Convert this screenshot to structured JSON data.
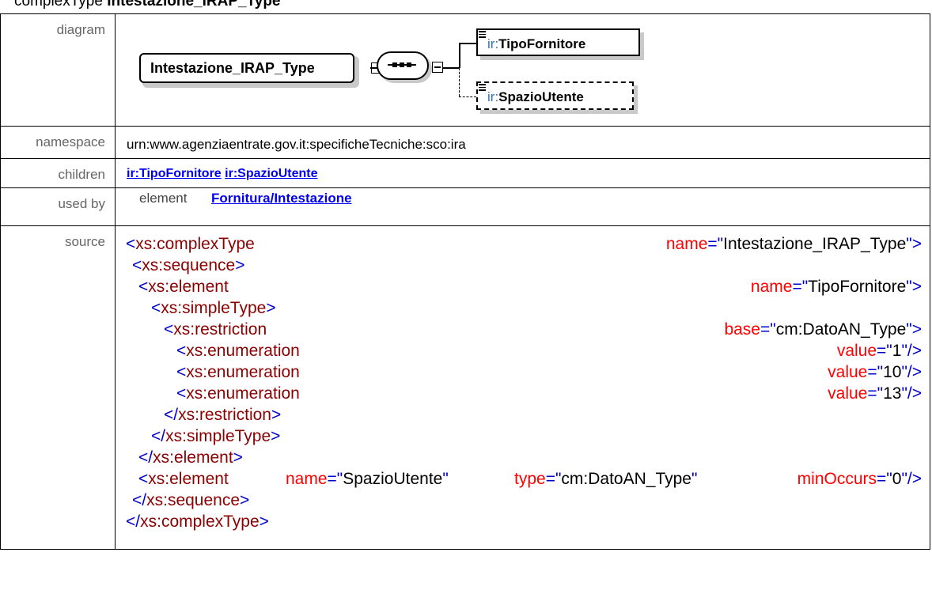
{
  "heading": {
    "kind": "complexType ",
    "name": "Intestazione_IRAP_Type"
  },
  "labels": {
    "diagram": "diagram",
    "namespace": "namespace",
    "children": "children",
    "used_by": "used by",
    "source": "source"
  },
  "diagram": {
    "type_name": "Intestazione_IRAP_Type",
    "elements": [
      {
        "prefix": "ir:",
        "name": "TipoFornitore"
      },
      {
        "prefix": "ir:",
        "name": "SpazioUtente"
      }
    ]
  },
  "namespace": "urn:www.agenziaentrate.gov.it:specificheTecniche:sco:ira",
  "children": [
    "ir:TipoFornitore",
    "ir:SpazioUtente"
  ],
  "used_by": {
    "kind": "element",
    "link": "Fornitura/Intestazione"
  },
  "source": {
    "l1": {
      "open": "<",
      "tag": "xs:complexType",
      "attr": "name",
      "eq": "=\"",
      "val": "Intestazione_IRAP_Type",
      "close": "\">"
    },
    "l2": {
      "open": "<",
      "tag": "xs:sequence",
      "close": ">"
    },
    "l3": {
      "open": "<",
      "tag": "xs:element",
      "attr": "name",
      "eq": "=\"",
      "val": "TipoFornitore",
      "close": "\">"
    },
    "l4": {
      "open": "<",
      "tag": "xs:simpleType",
      "close": ">"
    },
    "l5": {
      "open": "<",
      "tag": "xs:restriction",
      "attr": "base",
      "eq": "=\"",
      "val": "cm:DatoAN_Type",
      "close": "\">"
    },
    "l6": {
      "open": "<",
      "tag": "xs:enumeration",
      "attr": "value",
      "eq": "=\"",
      "val": "1",
      "close": "\"/>"
    },
    "l7": {
      "open": "<",
      "tag": "xs:enumeration",
      "attr": "value",
      "eq": "=\"",
      "val": "10",
      "close": "\"/>"
    },
    "l8": {
      "open": "<",
      "tag": "xs:enumeration",
      "attr": "value",
      "eq": "=\"",
      "val": "13",
      "close": "\"/>"
    },
    "l9": {
      "open": "</",
      "tag": "xs:restriction",
      "close": ">"
    },
    "l10": {
      "open": "</",
      "tag": "xs:simpleType",
      "close": ">"
    },
    "l11": {
      "open": "</",
      "tag": "xs:element",
      "close": ">"
    },
    "l12": {
      "open": "<",
      "tag": "xs:element",
      "a1": "name",
      "v1": "SpazioUtente",
      "a2": "type",
      "v2": "cm:DatoAN_Type",
      "a3": "minOccurs",
      "v3": "0",
      "eq": "=\"",
      "q": "\"",
      "close": "\"/>"
    },
    "l13": {
      "open": "</",
      "tag": "xs:sequence",
      "close": ">"
    },
    "l14": {
      "open": "</",
      "tag": "xs:complexType",
      "close": ">"
    }
  },
  "colors": {
    "tag": "#8b0000",
    "bracket": "#0000cc",
    "attr_name": "#ff0000",
    "link": "#0000ee",
    "prefix": "#2b74c8"
  }
}
